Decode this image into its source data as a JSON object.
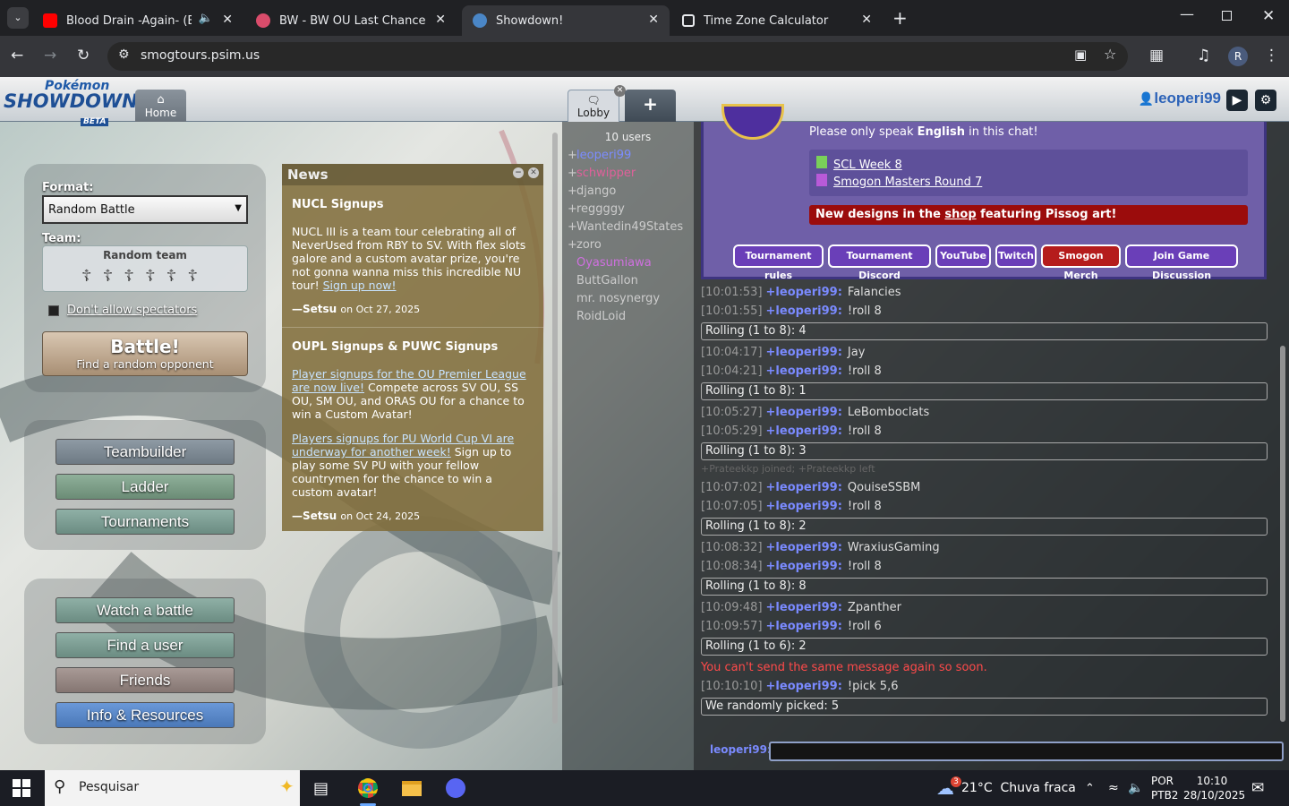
{
  "browser": {
    "tabs": [
      {
        "title": "Blood Drain -Again- (Eltnum"
      },
      {
        "title": "BW - BW OU Last Chance #2: R"
      },
      {
        "title": "Showdown!"
      },
      {
        "title": "Time Zone Calculator"
      }
    ],
    "url": "smogtours.psim.us",
    "profile_initial": "R"
  },
  "ps": {
    "logo_line1": "Pokémon",
    "logo_line2": "SHOWDOWN!",
    "logo_beta": "BETA",
    "home_tab": "Home",
    "lobby_tab": "Lobby",
    "plus_tab": "+",
    "username": "leoperi99",
    "format_label": "Format:",
    "format_value": "Random Battle",
    "team_label": "Team:",
    "team_value": "Random team",
    "spectators_label": "Don't allow spectators",
    "battle_title": "Battle!",
    "battle_sub": "Find a random opponent",
    "menu": {
      "teambuilder": "Teambuilder",
      "ladder": "Ladder",
      "tournaments": "Tournaments",
      "watch": "Watch a battle",
      "find": "Find a user",
      "friends": "Friends",
      "info": "Info & Resources"
    }
  },
  "news": {
    "header": "News",
    "items": [
      {
        "title": "NUCL Signups",
        "body": "NUCL III is a team tour celebrating all of NeverUsed from RBY to SV. With flex slots galore and a custom avatar prize, you're not gonna wanna miss this incredible NU tour!",
        "link": "Sign up now!",
        "author": "—Setsu",
        "date": "on Oct 27, 2025"
      },
      {
        "title": "OUPL Signups & PUWC Signups",
        "link1": "Player signups for the OU Premier League are now live!",
        "body1": " Compete across SV OU, SS OU, SM OU, and ORAS OU for a chance to win a Custom Avatar!",
        "link2": "Players signups for PU World Cup VI are underway for another week!",
        "body2": " Sign up to play some SV PU with your fellow countrymen for the chance to win a custom avatar!",
        "author": "—Setsu",
        "date": "on Oct 24, 2025"
      }
    ]
  },
  "userlist": {
    "count": "10 users",
    "users": [
      {
        "rank": "+",
        "name": "leoperi99",
        "color": "#7b8cff"
      },
      {
        "rank": "+",
        "name": "schwipper",
        "color": "#e0609a"
      },
      {
        "rank": "+",
        "name": "django",
        "color": "#cccccc"
      },
      {
        "rank": "+",
        "name": "reggggy",
        "color": "#cccccc"
      },
      {
        "rank": "+",
        "name": "Wantedin49States",
        "color": "#cccccc"
      },
      {
        "rank": "+",
        "name": "zoro",
        "color": "#cccccc"
      },
      {
        "rank": "",
        "name": "Oyasumiawa",
        "color": "#d070e0"
      },
      {
        "rank": "",
        "name": "ButtGallon",
        "color": "#cccccc"
      },
      {
        "rank": "",
        "name": "mr. nosynergy",
        "color": "#cccccc"
      },
      {
        "rank": "",
        "name": "RoidLoid",
        "color": "#cccccc"
      }
    ]
  },
  "banner": {
    "line1": "Please only speak English in this chat!",
    "line1_pre": "Please only speak ",
    "line1_bold": "English",
    "line1_post": " in this chat!",
    "link1": "SCL Week 8",
    "link2": "Smogon Masters Round 7",
    "shop_pre": "New designs in the ",
    "shop_link": "shop",
    "shop_post": " featuring Pissog art!",
    "buttons": [
      "Tournament rules",
      "Tournament Discord",
      "YouTube",
      "Twitch",
      "Smogon Merch",
      "Join Game Discussion"
    ]
  },
  "chat": {
    "rows": [
      {
        "ts": "[10:01:53]",
        "user": "+leoperi99:",
        "msg": "Falancies"
      },
      {
        "ts": "[10:01:55]",
        "user": "+leoperi99:",
        "msg": "!roll 8"
      },
      {
        "roll": "Rolling (1 to 8): 4"
      },
      {
        "ts": "[10:04:17]",
        "user": "+leoperi99:",
        "msg": "Jay"
      },
      {
        "ts": "[10:04:21]",
        "user": "+leoperi99:",
        "msg": "!roll 8"
      },
      {
        "roll": "Rolling (1 to 8): 1"
      },
      {
        "ts": "[10:05:27]",
        "user": "+leoperi99:",
        "msg": "LeBomboclats"
      },
      {
        "ts": "[10:05:29]",
        "user": "+leoperi99:",
        "msg": "!roll 8"
      },
      {
        "roll": "Rolling (1 to 8): 3"
      },
      {
        "join": "+Prateekkp joined; +Prateekkp left"
      },
      {
        "ts": "[10:07:02]",
        "user": "+leoperi99:",
        "msg": "QouiseSSBM"
      },
      {
        "ts": "[10:07:05]",
        "user": "+leoperi99:",
        "msg": "!roll 8"
      },
      {
        "roll": "Rolling (1 to 8): 2"
      },
      {
        "ts": "[10:08:32]",
        "user": "+leoperi99:",
        "msg": "WraxiusGaming"
      },
      {
        "ts": "[10:08:34]",
        "user": "+leoperi99:",
        "msg": "!roll 8"
      },
      {
        "roll": "Rolling (1 to 8): 8"
      },
      {
        "ts": "[10:09:48]",
        "user": "+leoperi99:",
        "msg": "Zpanther"
      },
      {
        "ts": "[10:09:57]",
        "user": "+leoperi99:",
        "msg": "!roll 6"
      },
      {
        "roll": "Rolling (1 to 6): 2"
      },
      {
        "error": "You can't send the same message again so soon."
      },
      {
        "ts": "[10:10:10]",
        "user": "+leoperi99:",
        "msg": "!pick 5,6"
      },
      {
        "roll": "We randomly picked:  5"
      }
    ],
    "input_label": "leoperi99:"
  },
  "taskbar": {
    "search": "Pesquisar",
    "weather": "21°C  Chuva fraca",
    "weather_badge": "3",
    "lang1": "POR",
    "lang2": "PTB2",
    "time": "10:10",
    "date": "28/10/2025"
  }
}
